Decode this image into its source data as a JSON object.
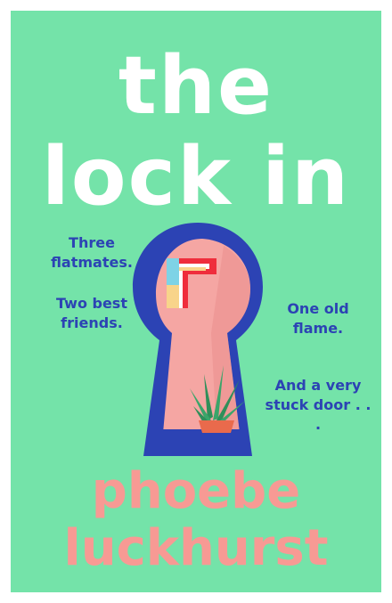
{
  "cover": {
    "title_line1": "the",
    "title_line2": "lock in",
    "tagline_left_1": "Three flatmates.",
    "tagline_left_2": "Two best friends.",
    "tagline_right_1": "One old flame.",
    "tagline_right_2": "And a very stuck door . . .",
    "author_first": "phoebe",
    "author_last": "luckhurst"
  },
  "colors": {
    "background": "#74e3a9",
    "title": "#ffffff",
    "tagline": "#2c43b4",
    "author": "#f79a94",
    "keyhole_blue": "#2c43b4",
    "keyhole_pink": "#f5a6a3"
  },
  "illustration": {
    "keyhole": "keyhole-icon",
    "plant": "aloe-plant-icon",
    "window": "window-frame-icon"
  }
}
